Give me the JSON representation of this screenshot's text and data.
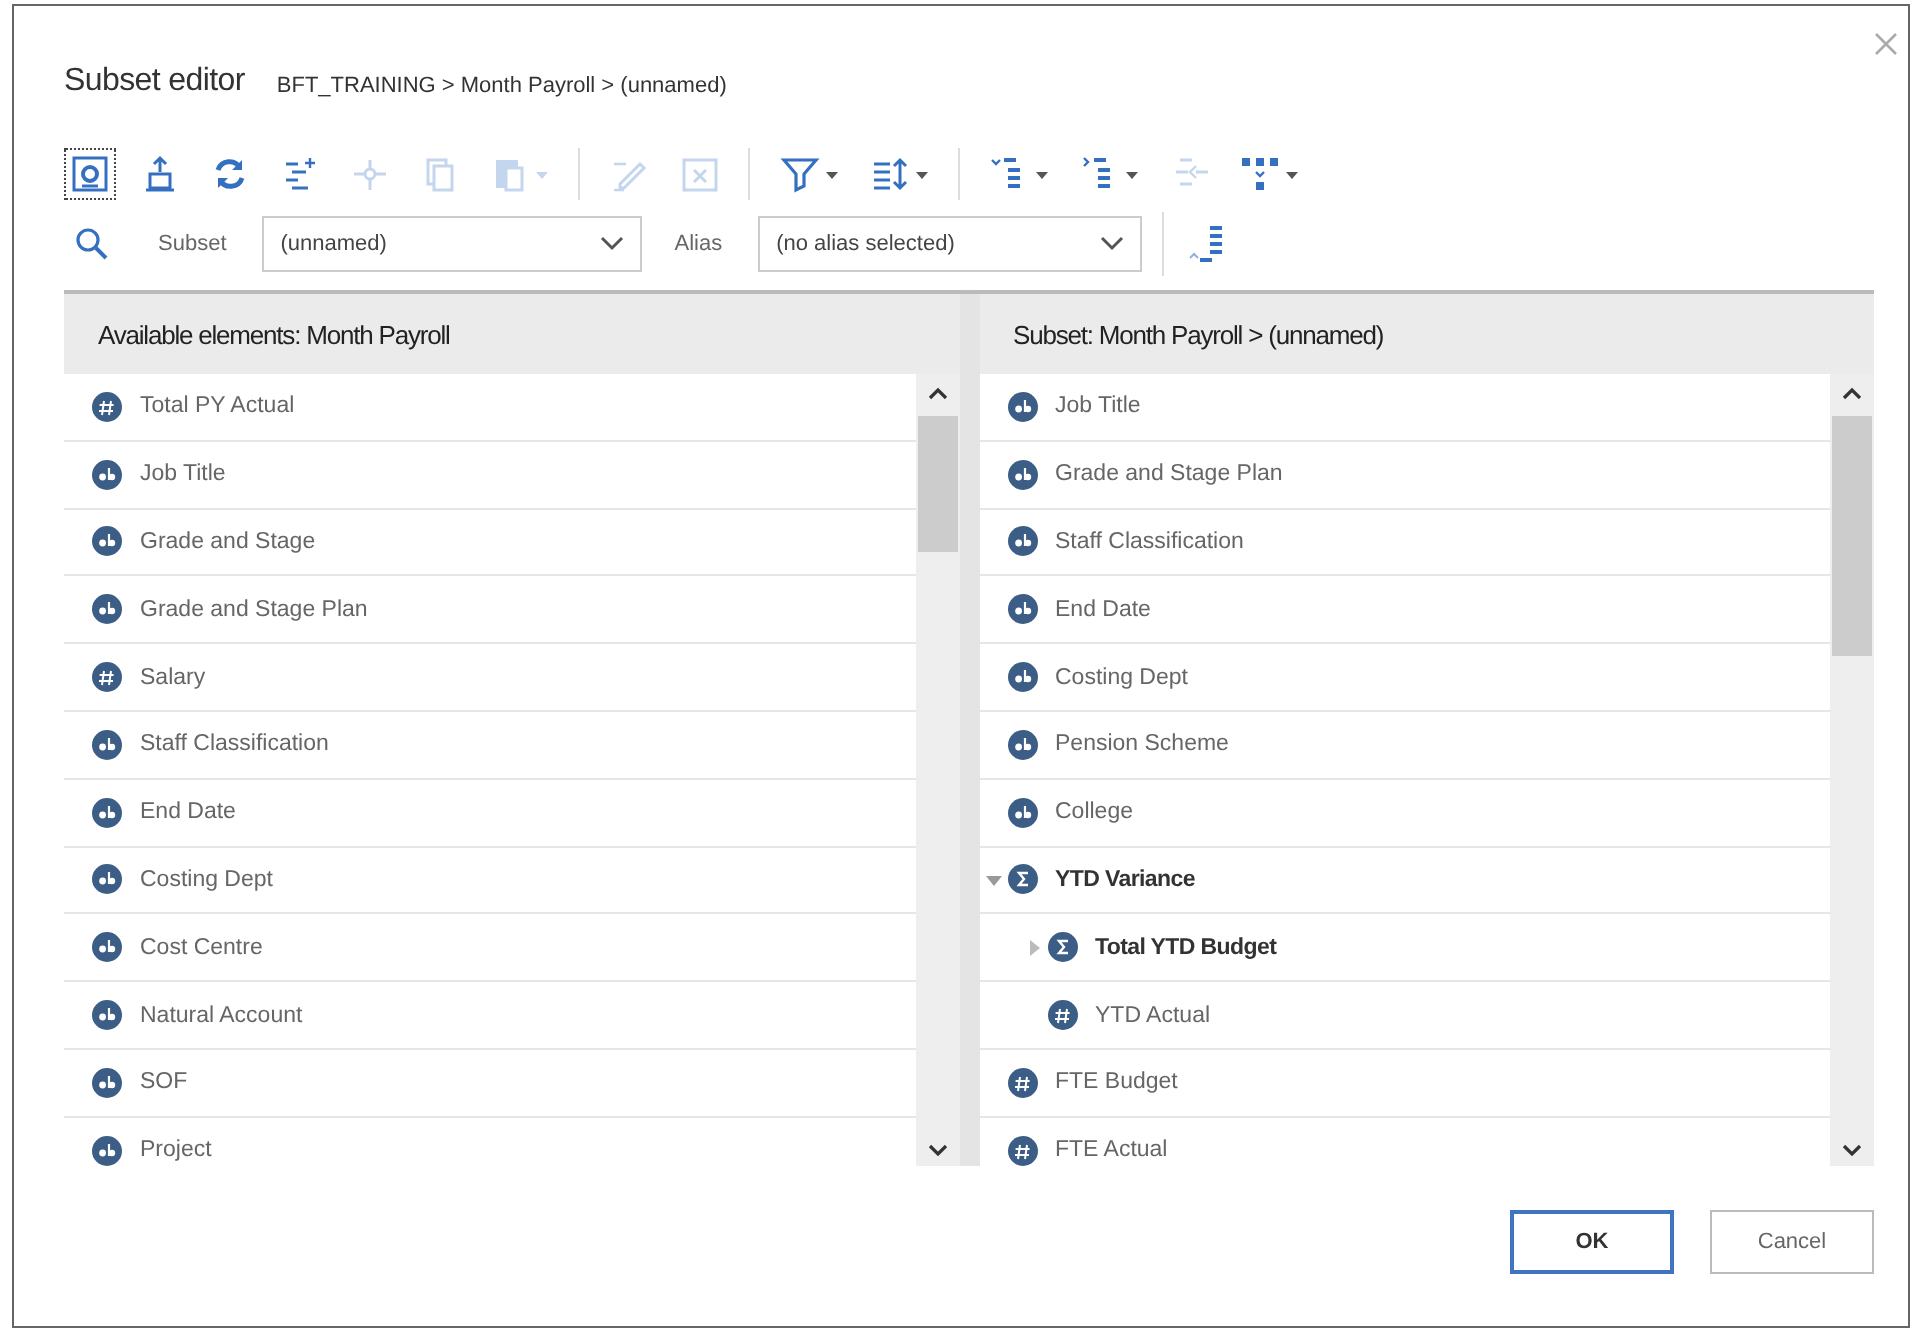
{
  "dialog": {
    "title": "Subset editor",
    "path": "BFT_TRAINING > Month Payroll > (unnamed)"
  },
  "toolbar": [
    {
      "kind": "select-all",
      "disabled": false,
      "focused": true
    },
    {
      "kind": "tray",
      "disabled": false
    },
    {
      "kind": "refresh",
      "disabled": false
    },
    {
      "kind": "insert",
      "disabled": false
    },
    {
      "kind": "split",
      "disabled": true
    },
    {
      "kind": "copy",
      "disabled": true
    },
    {
      "kind": "paste",
      "disabled": true,
      "dropdown": true
    },
    {
      "kind": "separator"
    },
    {
      "kind": "pen",
      "disabled": true
    },
    {
      "kind": "delete",
      "disabled": true
    },
    {
      "kind": "separator"
    },
    {
      "kind": "filter",
      "disabled": false,
      "dropdown": true
    },
    {
      "kind": "sort",
      "disabled": false,
      "dropdown": true
    },
    {
      "kind": "separator"
    },
    {
      "kind": "expand",
      "disabled": false,
      "dropdown": true
    },
    {
      "kind": "drill",
      "disabled": false,
      "dropdown": true
    },
    {
      "kind": "indent",
      "disabled": true
    },
    {
      "kind": "hierarchy",
      "disabled": false,
      "dropdown": true
    }
  ],
  "subset": {
    "label": "Subset",
    "value": "(unnamed)"
  },
  "alias": {
    "label": "Alias",
    "value": "(no alias selected)"
  },
  "available": {
    "title": "Available elements: Month Payroll",
    "items": [
      {
        "label": "Total PY Actual",
        "kind": "number"
      },
      {
        "label": "Job Title",
        "kind": "string"
      },
      {
        "label": "Grade and Stage",
        "kind": "string"
      },
      {
        "label": "Grade and Stage Plan",
        "kind": "string"
      },
      {
        "label": "Salary",
        "kind": "number"
      },
      {
        "label": "Staff Classification",
        "kind": "string"
      },
      {
        "label": "End Date",
        "kind": "string"
      },
      {
        "label": "Costing Dept",
        "kind": "string"
      },
      {
        "label": "Cost Centre",
        "kind": "string"
      },
      {
        "label": "Natural Account",
        "kind": "string"
      },
      {
        "label": "SOF",
        "kind": "string"
      },
      {
        "label": "Project",
        "kind": "string"
      }
    ]
  },
  "subset_panel": {
    "title": "Subset: Month Payroll > (unnamed)",
    "items": [
      {
        "label": "Job Title",
        "kind": "string"
      },
      {
        "label": "Grade and Stage Plan",
        "kind": "string"
      },
      {
        "label": "Staff Classification",
        "kind": "string"
      },
      {
        "label": "End Date",
        "kind": "string"
      },
      {
        "label": "Costing Dept",
        "kind": "string"
      },
      {
        "label": "Pension Scheme",
        "kind": "string"
      },
      {
        "label": "College",
        "kind": "string"
      },
      {
        "label": "YTD Variance",
        "kind": "consolidated",
        "expanded": true,
        "children": [
          {
            "label": "Total YTD Budget",
            "kind": "consolidated",
            "expanded": false
          },
          {
            "label": "YTD Actual",
            "kind": "number"
          }
        ]
      },
      {
        "label": "FTE Budget",
        "kind": "number"
      },
      {
        "label": "FTE Actual",
        "kind": "number"
      }
    ]
  },
  "buttons": [
    {
      "label": "OK",
      "kind": "primary"
    },
    {
      "label": "Cancel",
      "kind": "secondary"
    }
  ]
}
